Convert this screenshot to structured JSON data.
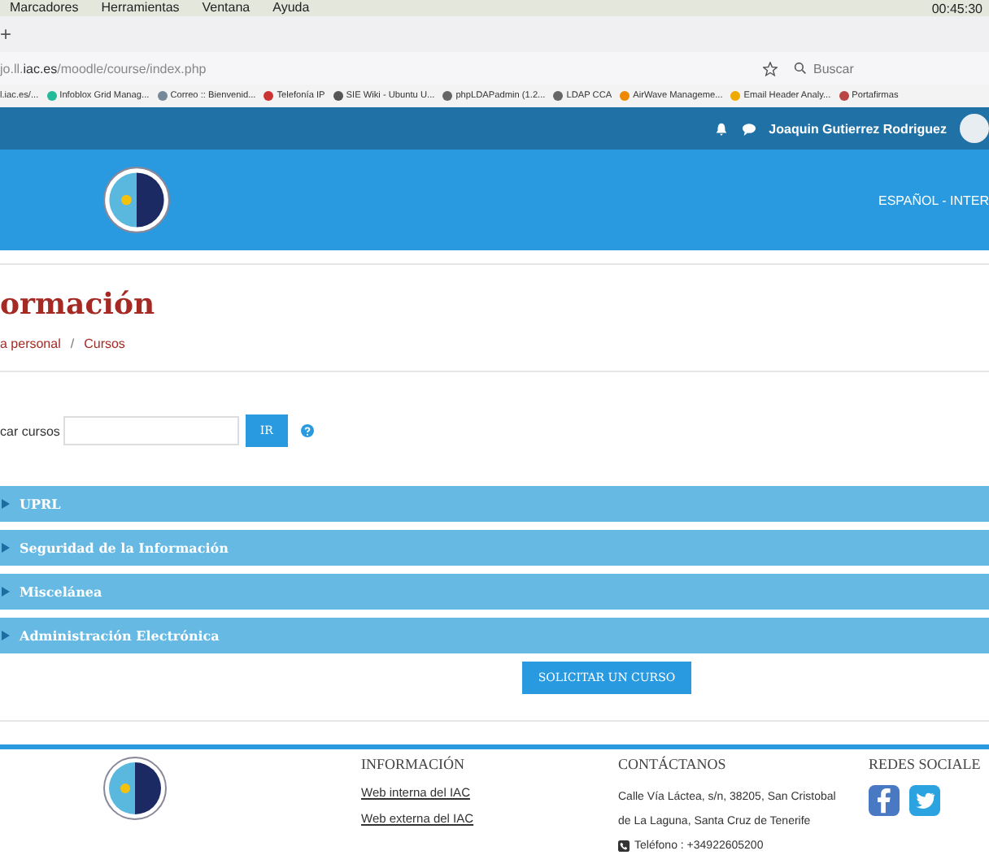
{
  "menu_bar": {
    "items": [
      "Marcadores",
      "Herramientas",
      "Ventana",
      "Ayuda"
    ],
    "clock": "00:45:30"
  },
  "tab_bar": {
    "new_tab": "+"
  },
  "address_bar": {
    "url_prefix": "jo.ll.",
    "url_domain": "iac.es",
    "url_path": "/moodle/course/index.php",
    "search_placeholder": "Buscar"
  },
  "bookmarks": [
    "l.iac.es/...",
    "Infoblox Grid Manag...",
    "Correo :: Bienvenid...",
    "Telefonía IP",
    "SIE Wiki - Ubuntu U...",
    "phpLDAPadmin (1.2...",
    "LDAP CCA",
    "AirWave Manageme...",
    "Email Header Analy...",
    "Portafirmas"
  ],
  "navbar": {
    "user": "Joaquin Gutierrez Rodriguez"
  },
  "header": {
    "language": "ESPAÑOL - INTER"
  },
  "page": {
    "title": "ormación",
    "breadcrumb_separator": "/",
    "breadcrumb": [
      {
        "label": "a personal"
      },
      {
        "label": "Cursos"
      }
    ]
  },
  "search": {
    "label": "car cursos",
    "button": "IR"
  },
  "categories": [
    {
      "name": "UPRL",
      "expanded": false
    },
    {
      "name": "Seguridad de la Información",
      "expanded": false
    },
    {
      "name": "Miscelánea",
      "expanded": false
    },
    {
      "name": "Administración Electrónica",
      "expanded": false
    }
  ],
  "request_button": "SOLICITAR UN CURSO",
  "footer": {
    "info_title": "INFORMACIÓN",
    "links": [
      "Web interna del IAC",
      "Web externa del IAC"
    ],
    "contact_title": "CONTÁCTANOS",
    "address": "Calle Vía Láctea, s/n, 38205, San Cristobal de La Laguna, Santa Cruz de Tenerife",
    "phone": "Teléfono : +34922605200",
    "social_title": "REDES SOCIALE"
  }
}
